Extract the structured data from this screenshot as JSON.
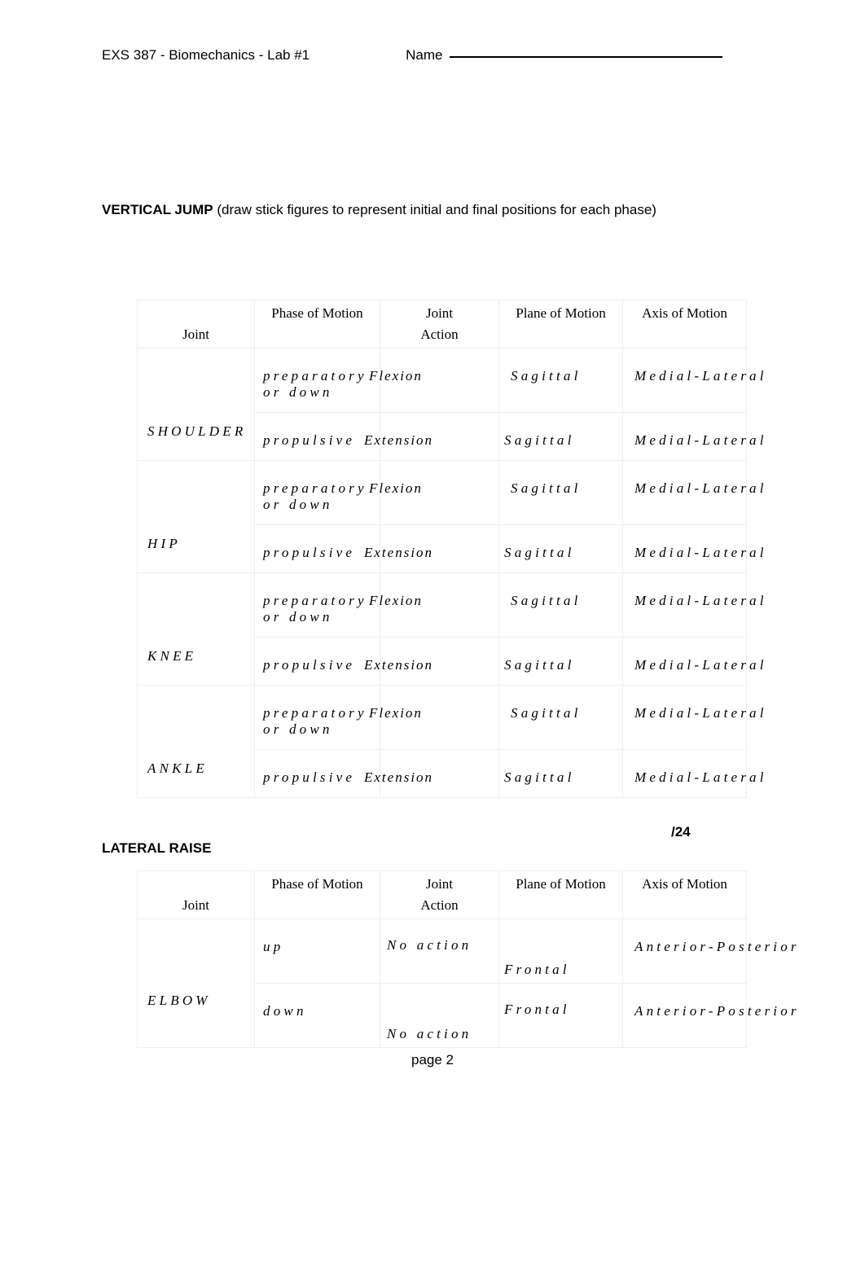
{
  "header": {
    "course": "EXS 387 - Biomechanics - Lab #1",
    "name_label": "Name"
  },
  "sections": {
    "vertical_jump": {
      "title_strong": "VERTICAL JUMP",
      "title_rest": " (draw stick figures to represent initial and final positions for each phase)",
      "score": "/24"
    },
    "lateral_raise": {
      "title": "LATERAL RAISE"
    }
  },
  "footer": {
    "page_label": "page 2"
  },
  "table_headers": {
    "joint": "Joint",
    "phase_of_motion": "Phase of Motion",
    "joint_top": "Joint",
    "action_bottom": "Action",
    "plane_of_motion": "Plane of Motion",
    "axis_of_motion": "Axis of Motion"
  },
  "vertical_jump_rows": [
    {
      "joint": "SHOULDER",
      "phases": [
        {
          "phase_line1": "preparatory",
          "phase_line2": "or  down",
          "action": "Flexion",
          "plane": "Sagittal",
          "axis": "Medial-Lateral"
        },
        {
          "phase_line1": "propulsive",
          "phase_line2": "",
          "action": "Extension",
          "plane": "Sagittal",
          "axis": "Medial-Lateral"
        }
      ]
    },
    {
      "joint": "HIP",
      "phases": [
        {
          "phase_line1": "preparatory",
          "phase_line2": "or  down",
          "action": "Flexion",
          "plane": "Sagittal",
          "axis": "Medial-Lateral"
        },
        {
          "phase_line1": "propulsive",
          "phase_line2": "",
          "action": "Extension",
          "plane": "Sagittal",
          "axis": "Medial-Lateral"
        }
      ]
    },
    {
      "joint": "KNEE",
      "phases": [
        {
          "phase_line1": "preparatory",
          "phase_line2": "or  down",
          "action": "Flexion",
          "plane": "Sagittal",
          "axis": "Medial-Lateral"
        },
        {
          "phase_line1": "propulsive",
          "phase_line2": "",
          "action": "Extension",
          "plane": "Sagittal",
          "axis": "Medial-Lateral"
        }
      ]
    },
    {
      "joint": "ANKLE",
      "phases": [
        {
          "phase_line1": "preparatory",
          "phase_line2": "or  down",
          "action": "Flexion",
          "plane": "Sagittal",
          "axis": "Medial-Lateral"
        },
        {
          "phase_line1": "propulsive",
          "phase_line2": "",
          "action": "Extension",
          "plane": "Sagittal",
          "axis": "Medial-Lateral"
        }
      ]
    }
  ],
  "lateral_raise_rows": [
    {
      "joint": "ELBOW",
      "phases": [
        {
          "phase_line1": "up",
          "action": "No  action",
          "plane": "Frontal",
          "axis": "Anterior-Posterior"
        },
        {
          "phase_line1": "down",
          "action": "No  action",
          "plane": "Frontal",
          "axis": "Anterior-Posterior"
        }
      ]
    }
  ]
}
